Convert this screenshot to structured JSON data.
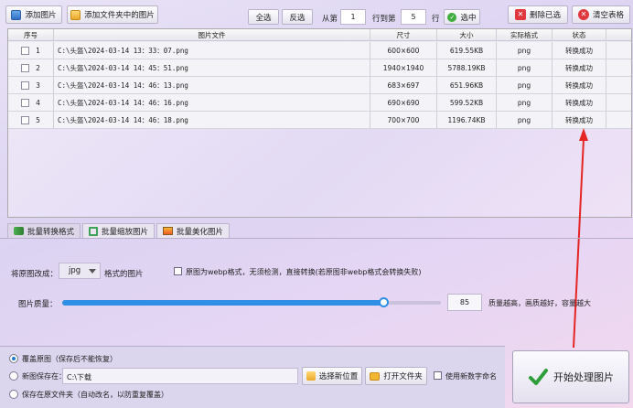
{
  "toolbar": {
    "add_image": "添加图片",
    "add_folder": "添加文件夹中的图片",
    "select_all": "全选",
    "invert": "反选",
    "from_row_label": "从第",
    "from_row_value": "1",
    "to_row_label": "行到第",
    "to_row_value": "5",
    "row_suffix": "行",
    "select_button": "选中",
    "delete_selected": "删除已选",
    "clear_table": "清空表格"
  },
  "table": {
    "headers": [
      "序号",
      "图片文件",
      "尺寸",
      "大小",
      "实际格式",
      "状态"
    ],
    "rows": [
      {
        "idx": "1",
        "file": "C:\\头盔\\2024-03-14  13：33：07.png",
        "size": "600×600",
        "kb": "619.55KB",
        "fmt": "png",
        "status": "转换成功"
      },
      {
        "idx": "2",
        "file": "C:\\头盔\\2024-03-14  14：45：51.png",
        "size": "1940×1940",
        "kb": "5788.19KB",
        "fmt": "png",
        "status": "转换成功"
      },
      {
        "idx": "3",
        "file": "C:\\头盔\\2024-03-14  14：46：13.png",
        "size": "683×697",
        "kb": "651.96KB",
        "fmt": "png",
        "status": "转换成功"
      },
      {
        "idx": "4",
        "file": "C:\\头盔\\2024-03-14  14：46：16.png",
        "size": "690×690",
        "kb": "599.52KB",
        "fmt": "png",
        "status": "转换成功"
      },
      {
        "idx": "5",
        "file": "C:\\头盔\\2024-03-14  14：46：18.png",
        "size": "700×700",
        "kb": "1196.74KB",
        "fmt": "png",
        "status": "转换成功"
      }
    ]
  },
  "tabs": [
    "批量转换格式",
    "批量缩放图片",
    "批量美化图片"
  ],
  "convert": {
    "label": "将原图改成：",
    "format": "jpg",
    "suffix": "格式的图片",
    "webp_option": "原图为webp格式，无须检测，直接转换(若原图非webp格式会转换失败)",
    "quality_label": "图片质量：",
    "quality_value": "85",
    "quality_note": "质量越高，画质越好，容量越大",
    "quality_fraction": 0.85
  },
  "output": {
    "overwrite": "覆盖原图（保存后不能恢复）",
    "new_path_label": "新图保存在：",
    "new_path_value": "C:\\下载",
    "choose_location": "选择新位置",
    "open_folder": "打开文件夹",
    "use_numbers": "使用新数字命名",
    "save_original": "保存在原文件夹（自动改名，以防重复覆盖）",
    "start": "开始处理图片"
  }
}
